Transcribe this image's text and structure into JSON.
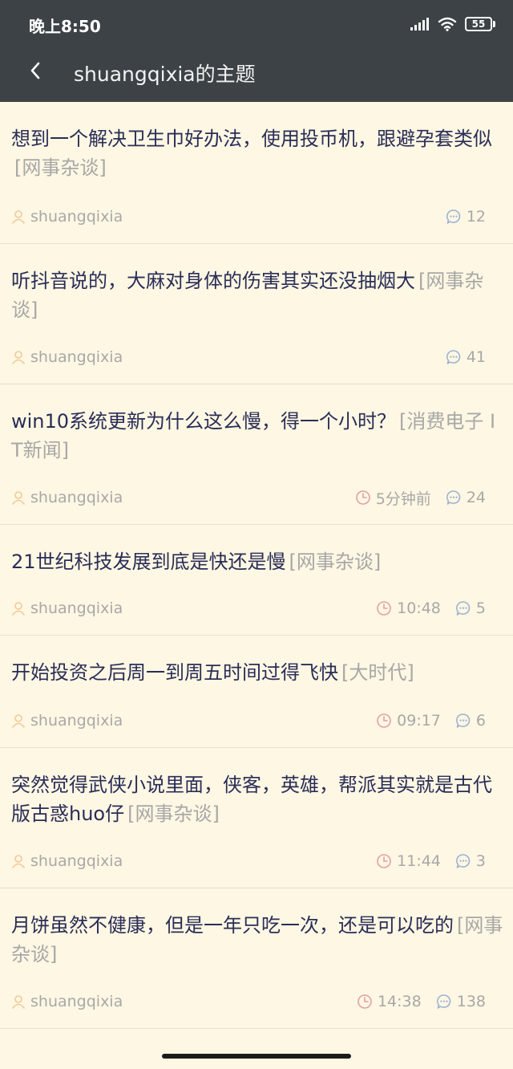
{
  "status_bar": {
    "time": "晚上8:50",
    "battery": "55",
    "icons": [
      "signal-icon",
      "wifi-icon",
      "battery-icon"
    ]
  },
  "nav": {
    "back_icon": "chevron-left-icon",
    "title": "shuangqixia的主题"
  },
  "colors": {
    "header_bg": "#3c4246",
    "page_bg": "#fdf7e3",
    "title_text": "#2a2d57",
    "category_text": "#a7a7a7",
    "user_icon": "#f2c995",
    "clock_icon": "#e2a0a8",
    "comment_icon": "#9cb2d3"
  },
  "topics": [
    {
      "title": "想到一个解决卫生巾好办法，使用投币机，跟避孕套类似",
      "category": "[网事杂谈]",
      "author": "shuangqixia",
      "time": "",
      "comments": "12"
    },
    {
      "title": "听抖音说的，大麻对身体的伤害其实还没抽烟大",
      "category": "[网事杂谈]",
      "author": "shuangqixia",
      "time": "",
      "comments": "41"
    },
    {
      "title": "win10系统更新为什么这么慢，得一个小时？",
      "category": "[消费电子 IT新闻]",
      "author": "shuangqixia",
      "time": "5分钟前",
      "comments": "24"
    },
    {
      "title": "21世纪科技发展到底是快还是慢",
      "category": "[网事杂谈]",
      "author": "shuangqixia",
      "time": "10:48",
      "comments": "5"
    },
    {
      "title": "开始投资之后周一到周五时间过得飞快",
      "category": "[大时代]",
      "author": "shuangqixia",
      "time": "09:17",
      "comments": "6"
    },
    {
      "title": "突然觉得武侠小说里面，侠客，英雄，帮派其实就是古代版古惑huo仔",
      "category": "[网事杂谈]",
      "author": "shuangqixia",
      "time": "11:44",
      "comments": "3"
    },
    {
      "title": "月饼虽然不健康，但是一年只吃一次，还是可以吃的",
      "category": "[网事杂谈]",
      "author": "shuangqixia",
      "time": "14:38",
      "comments": "138"
    }
  ]
}
